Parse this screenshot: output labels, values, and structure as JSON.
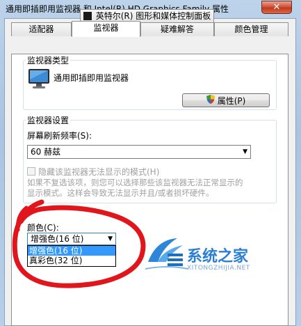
{
  "window": {
    "title": "通用即插即用监视器 和 Intel(R) HD Graphics Family 属性",
    "close_glyph": "✕"
  },
  "tabs": {
    "intel": "英特尔(R) 图形和媒体控制面板",
    "adapter": "适配器",
    "monitor": "监视器",
    "troubleshoot": "疑难解答",
    "color_management": "颜色管理"
  },
  "monitor_type": {
    "group_title": "监视器类型",
    "name": "通用即插即用监视器",
    "properties_button": "属性(P)"
  },
  "monitor_settings": {
    "group_title": "监视器设置",
    "refresh_label": "屏幕刷新频率(S):",
    "refresh_value": "60 赫兹",
    "hide_modes_label": "隐藏该监视器无法显示的模式(H)",
    "hide_modes_checked": false,
    "warning_line1": "如果不复选该项，则您可以选择那些该监视器无法正常显示的",
    "warning_line2": "显示模式。这样会导致无法显示并且/或者损坏硬件。"
  },
  "colors": {
    "label": "颜色(C):",
    "selected": "增强色(16 位)",
    "options": [
      "增强色(16 位)",
      "真彩色(32 位)"
    ],
    "highlighted_index": 0
  },
  "watermark": {
    "name": "系统之家",
    "url": "XITONGZHIJIA.NET"
  },
  "annotation_color": "#e0161c",
  "accent_color": "#3399ff"
}
